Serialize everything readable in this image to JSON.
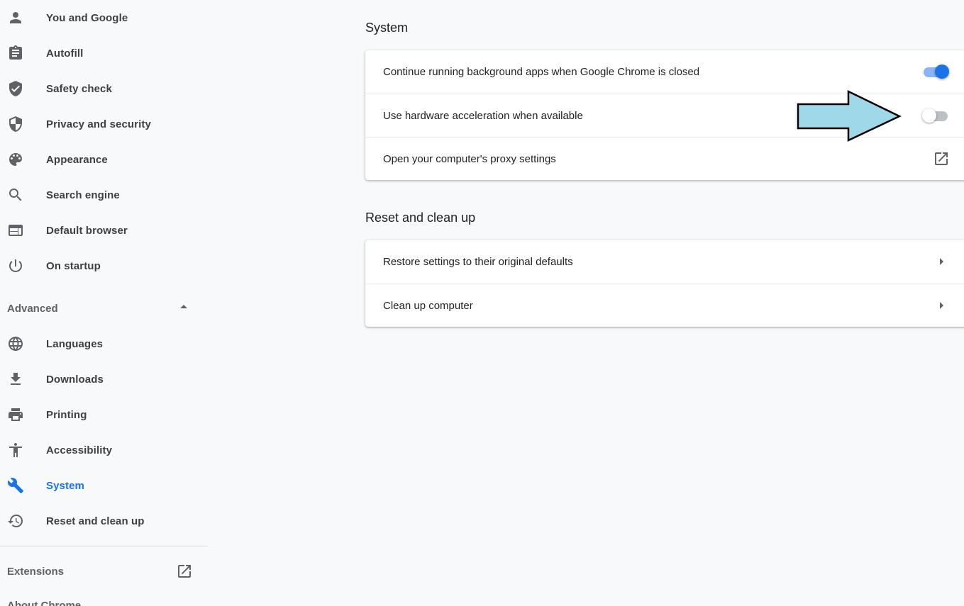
{
  "sidebar": {
    "items": [
      {
        "label": "You and Google",
        "icon": "person-icon"
      },
      {
        "label": "Autofill",
        "icon": "clipboard-icon"
      },
      {
        "label": "Safety check",
        "icon": "shield-check-icon"
      },
      {
        "label": "Privacy and security",
        "icon": "shield-icon"
      },
      {
        "label": "Appearance",
        "icon": "palette-icon"
      },
      {
        "label": "Search engine",
        "icon": "search-icon"
      },
      {
        "label": "Default browser",
        "icon": "browser-window-icon"
      },
      {
        "label": "On startup",
        "icon": "power-icon"
      }
    ],
    "advanced_label": "Advanced",
    "advanced_items": [
      {
        "label": "Languages",
        "icon": "globe-icon"
      },
      {
        "label": "Downloads",
        "icon": "download-icon"
      },
      {
        "label": "Printing",
        "icon": "printer-icon"
      },
      {
        "label": "Accessibility",
        "icon": "accessibility-icon"
      },
      {
        "label": "System",
        "icon": "wrench-icon",
        "active": true
      },
      {
        "label": "Reset and clean up",
        "icon": "history-icon"
      }
    ],
    "extensions_label": "Extensions",
    "about_label": "About Chrome"
  },
  "system": {
    "title": "System",
    "rows": [
      {
        "label": "Continue running background apps when Google Chrome is closed",
        "toggle": true
      },
      {
        "label": "Use hardware acceleration when available",
        "toggle": false
      },
      {
        "label": "Open your computer's proxy settings",
        "icon": "open-external-icon"
      }
    ]
  },
  "reset": {
    "title": "Reset and clean up",
    "rows": [
      {
        "label": "Restore settings to their original defaults"
      },
      {
        "label": "Clean up computer"
      }
    ]
  },
  "colors": {
    "accent": "#1a73e8",
    "arrow_fill": "#9fd8e8"
  }
}
